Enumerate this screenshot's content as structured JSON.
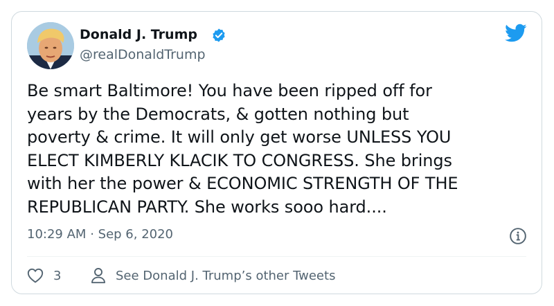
{
  "author": {
    "name": "Donald J. Trump",
    "handle": "@realDonaldTrump",
    "verified": true,
    "avatar_icon": "avatar-photo"
  },
  "tweet": {
    "text": "Be smart Baltimore! You have been ripped off for\nyears by the Democrats, & gotten nothing but\npoverty & crime. It will only get worse UNLESS YOU\nELECT KIMBERLY KLACIK TO CONGRESS. She brings\nwith her the power & ECONOMIC STRENGTH OF THE\nREPUBLICAN PARTY. She works sooo hard....",
    "time": "10:29 AM",
    "separator": "·",
    "date": "Sep 6, 2020"
  },
  "actions": {
    "like_count": "3",
    "see_others_label": "See Donald J. Trump’s other Tweets"
  },
  "icons": {
    "brand": "twitter-bird-icon",
    "verified": "verified-badge-icon",
    "info": "info-icon",
    "like": "heart-icon",
    "profile": "person-icon"
  },
  "colors": {
    "brand": "#1d9bf0",
    "text": "#0f1419",
    "secondary": "#536471",
    "border": "#cfd9de"
  }
}
